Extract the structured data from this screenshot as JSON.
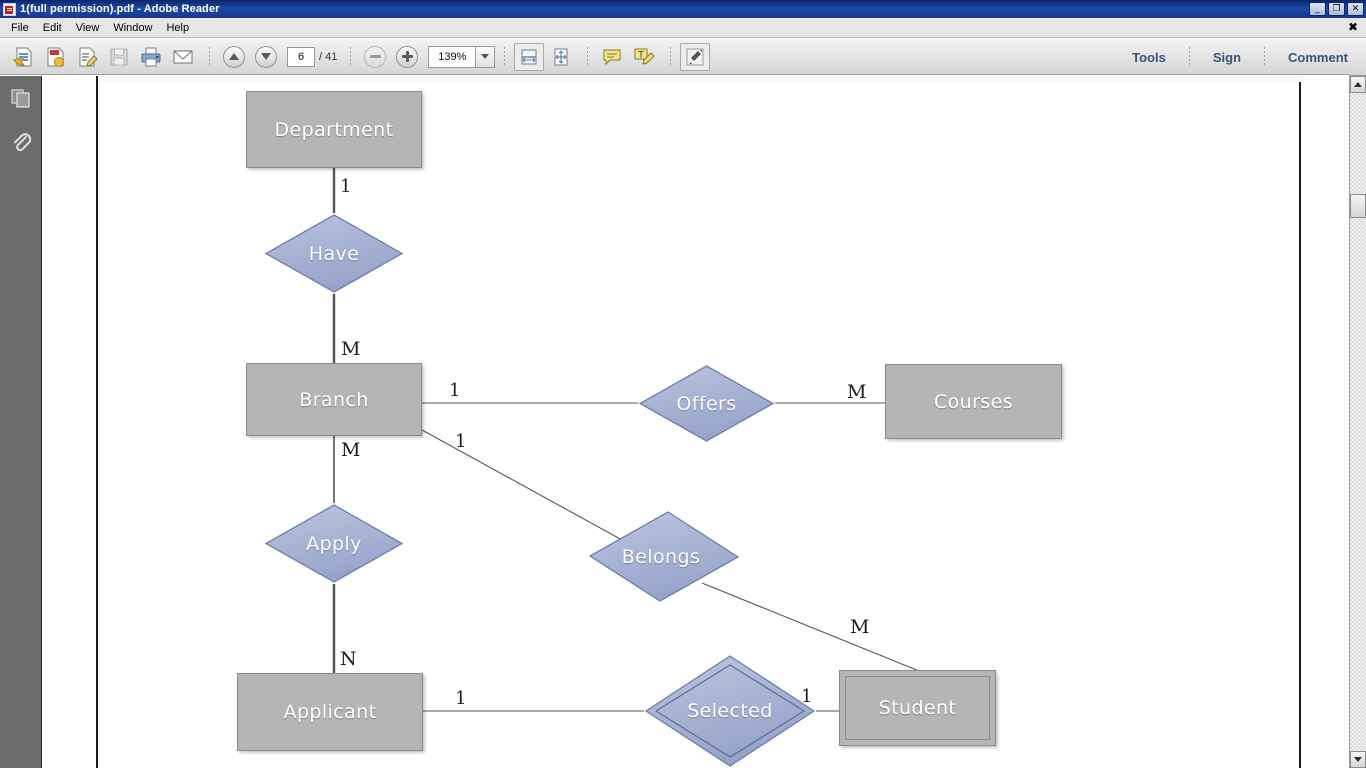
{
  "window": {
    "title": "1(full permission).pdf - Adobe Reader",
    "app_icon": "pdf-file-icon",
    "minimize": "_",
    "maximize": "❐",
    "close": "✕"
  },
  "menubar": {
    "items": [
      "File",
      "Edit",
      "View",
      "Window",
      "Help"
    ],
    "close_label": "✖"
  },
  "toolbar": {
    "buttons": [
      {
        "name": "open-file-button",
        "icon": "open-document-icon"
      },
      {
        "name": "create-pdf-button",
        "icon": "create-pdf-icon"
      },
      {
        "name": "edit-pdf-button",
        "icon": "edit-pdf-icon"
      },
      {
        "name": "save-button",
        "icon": "floppy-save-icon"
      },
      {
        "name": "print-button",
        "icon": "printer-icon"
      },
      {
        "name": "email-button",
        "icon": "envelope-icon"
      }
    ],
    "previous_page": "previous-page-icon",
    "next_page": "next-page-icon",
    "page_number": "6",
    "page_total": "/ 41",
    "zoom_out": "zoom-out-icon",
    "zoom_in": "zoom-in-icon",
    "zoom_level": "139%",
    "zoom_dropdown": "chevron-down-icon",
    "fit_width": "fit-width-icon",
    "fit_page": "fit-page-icon",
    "sticky_note": "comment-balloon-icon",
    "highlight_text": "highlight-text-icon",
    "read_mode": "read-mode-expand-icon",
    "right_commands": [
      "Tools",
      "Sign",
      "Comment"
    ]
  },
  "navpane": {
    "items": [
      {
        "name": "page-thumbnails-button",
        "icon": "page-thumbnails-icon"
      },
      {
        "name": "attachments-button",
        "icon": "paperclip-icon"
      }
    ]
  },
  "scrollbar": {
    "up": "scroll-up-arrow-icon",
    "down": "scroll-down-arrow-icon"
  },
  "diagram": {
    "type": "entity-relationship-diagram",
    "colors": {
      "entity_fill": "#b5b5b5",
      "entity_border": "#8b8b8b",
      "relationship_fill": "#a5b1d4",
      "relationship_border": "#6f7fa8",
      "label_text": "#ffffff",
      "cardinality_text": "#1b1b1b",
      "connector": "#555555"
    },
    "entities": [
      {
        "id": "department",
        "label": "Department",
        "weak": false
      },
      {
        "id": "branch",
        "label": "Branch",
        "weak": false
      },
      {
        "id": "courses",
        "label": "Courses",
        "weak": false
      },
      {
        "id": "applicant",
        "label": "Applicant",
        "weak": false
      },
      {
        "id": "student",
        "label": "Student",
        "weak": true
      }
    ],
    "relationships": [
      {
        "id": "have",
        "label": "Have",
        "identifying": false
      },
      {
        "id": "offers",
        "label": "Offers",
        "identifying": false
      },
      {
        "id": "apply",
        "label": "Apply",
        "identifying": false
      },
      {
        "id": "belongs",
        "label": "Belongs",
        "identifying": false
      },
      {
        "id": "selected",
        "label": "Selected",
        "identifying": true
      }
    ],
    "cardinalities": [
      {
        "id": "dept-have",
        "value": "1"
      },
      {
        "id": "have-branch",
        "value": "M"
      },
      {
        "id": "branch-offers",
        "value": "1"
      },
      {
        "id": "offers-courses",
        "value": "M"
      },
      {
        "id": "branch-belongs",
        "value": "1"
      },
      {
        "id": "branch-apply",
        "value": "M"
      },
      {
        "id": "apply-applicant",
        "value": "N"
      },
      {
        "id": "belongs-student",
        "value": "M"
      },
      {
        "id": "applicant-sel",
        "value": "1"
      },
      {
        "id": "sel-student",
        "value": "1"
      }
    ],
    "connections": [
      {
        "from": "department",
        "to": "have",
        "cardinality": "1"
      },
      {
        "from": "have",
        "to": "branch",
        "cardinality": "M"
      },
      {
        "from": "branch",
        "to": "offers",
        "cardinality": "1"
      },
      {
        "from": "offers",
        "to": "courses",
        "cardinality": "M"
      },
      {
        "from": "branch",
        "to": "belongs",
        "cardinality": "1"
      },
      {
        "from": "belongs",
        "to": "student",
        "cardinality": "M"
      },
      {
        "from": "branch",
        "to": "apply",
        "cardinality": "M"
      },
      {
        "from": "apply",
        "to": "applicant",
        "cardinality": "N"
      },
      {
        "from": "applicant",
        "to": "selected",
        "cardinality": "1"
      },
      {
        "from": "selected",
        "to": "student",
        "cardinality": "1"
      }
    ]
  }
}
